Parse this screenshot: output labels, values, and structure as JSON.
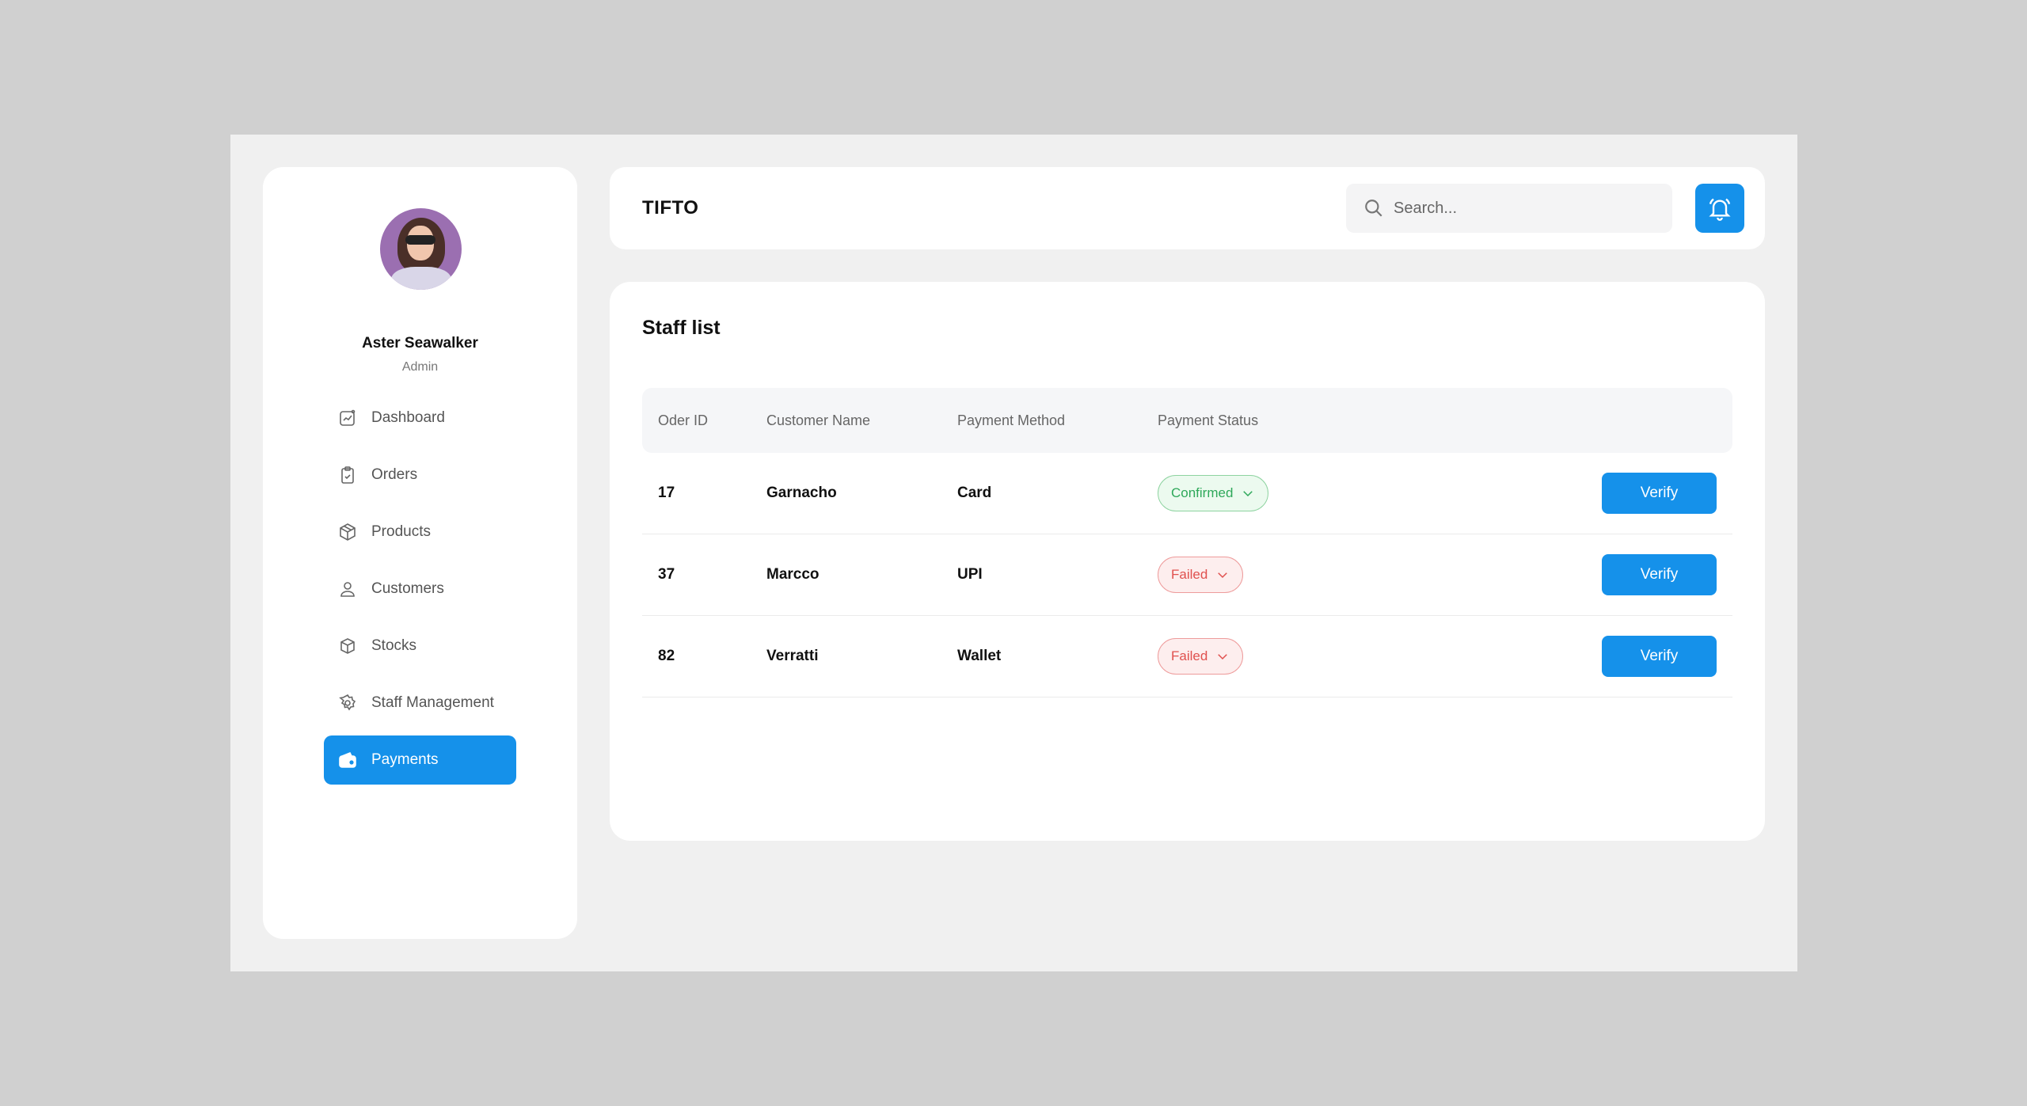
{
  "user": {
    "name": "Aster Seawalker",
    "role": "Admin"
  },
  "sidebar": {
    "items": [
      {
        "label": "Dashboard",
        "icon": "dashboard-icon",
        "active": false
      },
      {
        "label": "Orders",
        "icon": "clipboard-icon",
        "active": false
      },
      {
        "label": "Products",
        "icon": "box-icon",
        "active": false
      },
      {
        "label": "Customers",
        "icon": "user-icon",
        "active": false
      },
      {
        "label": "Stocks",
        "icon": "cube-icon",
        "active": false
      },
      {
        "label": "Staff Management",
        "icon": "gear-icon",
        "active": false
      },
      {
        "label": "Payments",
        "icon": "wallet-icon",
        "active": true
      }
    ]
  },
  "header": {
    "brand": "TIFTO",
    "search_placeholder": "Search...",
    "accent": "#1591ea"
  },
  "main": {
    "title": "Staff list",
    "columns": [
      "Oder ID",
      "Customer Name",
      "Payment Method",
      "Payment Status"
    ],
    "rows": [
      {
        "id": "17",
        "customer": "Garnacho",
        "method": "Card",
        "status": "Confirmed",
        "action": "Verify"
      },
      {
        "id": "37",
        "customer": "Marcco",
        "method": "UPI",
        "status": "Failed",
        "action": "Verify"
      },
      {
        "id": "82",
        "customer": "Verratti",
        "method": "Wallet",
        "status": "Failed",
        "action": "Verify"
      }
    ]
  },
  "colors": {
    "confirmed": "#2ea85a",
    "failed": "#e0504e"
  }
}
